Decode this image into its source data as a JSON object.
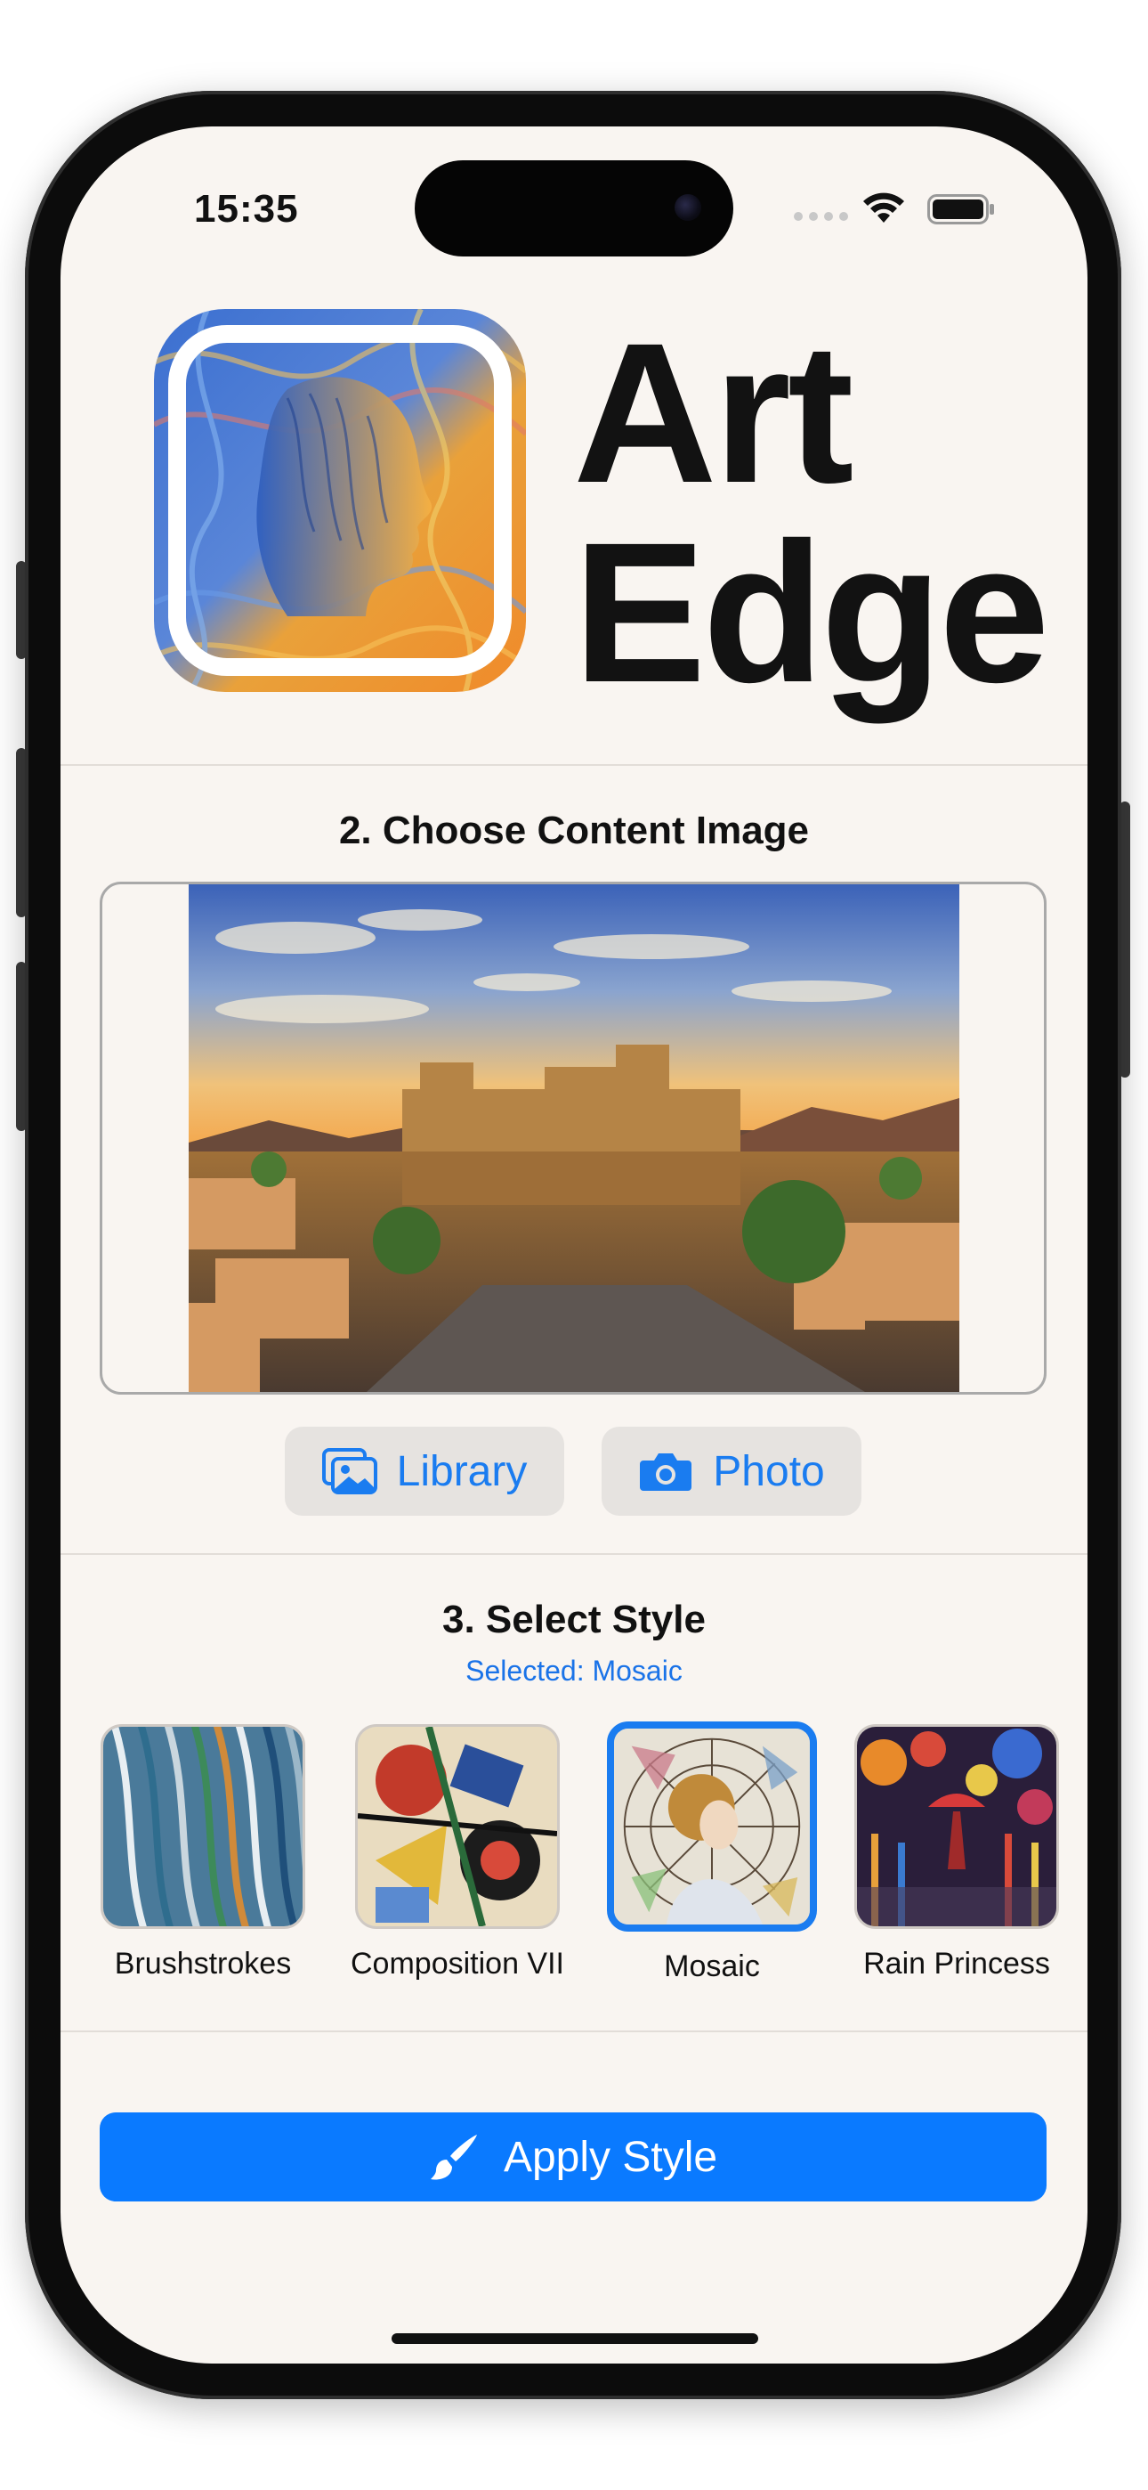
{
  "status_bar": {
    "time": "15:35"
  },
  "header": {
    "title_line1": "Art",
    "title_line2": "Edge"
  },
  "content_section": {
    "title": "2. Choose Content Image",
    "library_label": "Library",
    "photo_label": "Photo"
  },
  "style_section": {
    "title": "3. Select Style",
    "selected_text": "Selected: Mosaic",
    "styles": [
      {
        "label": "Brushstrokes"
      },
      {
        "label": "Composition VII"
      },
      {
        "label": "Mosaic",
        "selected": true
      },
      {
        "label": "Rain Princess"
      }
    ]
  },
  "apply_button": {
    "label": "Apply Style"
  },
  "colors": {
    "accent": "#0a7aff",
    "background": "#f9f5f1",
    "link": "#1a7cf0"
  }
}
